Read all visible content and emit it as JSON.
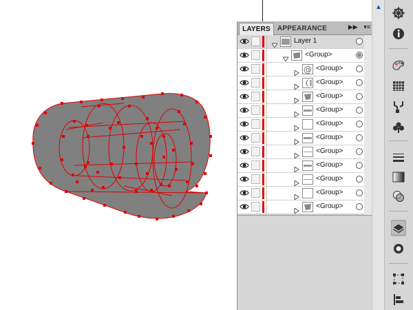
{
  "panel": {
    "tabs": [
      {
        "label": "LAYERS",
        "active": true
      },
      {
        "label": "APPEARANCE",
        "active": false
      }
    ],
    "menu_icon": "panel-menu-icon",
    "collapse_icon": "double-chevron-icon"
  },
  "layers": [
    {
      "name": "Layer 1",
      "level": 0,
      "expanded": true,
      "targeted": false,
      "selected_row": true
    },
    {
      "name": "<Group>",
      "level": 1,
      "expanded": true,
      "targeted": true
    },
    {
      "name": "<Group>",
      "level": 2,
      "expanded": false,
      "targeted": false,
      "thumb": "at-sign"
    },
    {
      "name": "<Group>",
      "level": 2,
      "expanded": false,
      "targeted": false,
      "thumb": "crescent"
    },
    {
      "name": "<Group>",
      "level": 2,
      "expanded": false,
      "targeted": false,
      "thumb": "shape"
    },
    {
      "name": "<Group>",
      "level": 2,
      "expanded": false,
      "targeted": false,
      "thumb": "bar"
    },
    {
      "name": "<Group>",
      "level": 2,
      "expanded": false,
      "targeted": false,
      "thumb": "blank"
    },
    {
      "name": "<Group>",
      "level": 2,
      "expanded": false,
      "targeted": false,
      "thumb": "bar"
    },
    {
      "name": "<Group>",
      "level": 2,
      "expanded": false,
      "targeted": false,
      "thumb": "line"
    },
    {
      "name": "<Group>",
      "level": 2,
      "expanded": false,
      "targeted": false,
      "thumb": "bar"
    },
    {
      "name": "<Group>",
      "level": 2,
      "expanded": false,
      "targeted": false,
      "thumb": "line"
    },
    {
      "name": "<Group>",
      "level": 2,
      "expanded": false,
      "targeted": false,
      "thumb": "blank"
    },
    {
      "name": "<Group>",
      "level": 2,
      "expanded": false,
      "targeted": false,
      "thumb": "shape"
    }
  ],
  "dock_icons": [
    "navigator-icon",
    "info-icon",
    "color-guide-icon",
    "swatches-icon",
    "brushes-icon",
    "symbols-icon",
    "stroke-icon",
    "gradient-icon",
    "transparency-icon",
    "layers-icon",
    "appearance-icon",
    "transform-icon",
    "align-icon"
  ],
  "colors": {
    "selection": "#e00000",
    "artwork_fill": "#808080",
    "panel_bg": "#d6d6d6"
  }
}
